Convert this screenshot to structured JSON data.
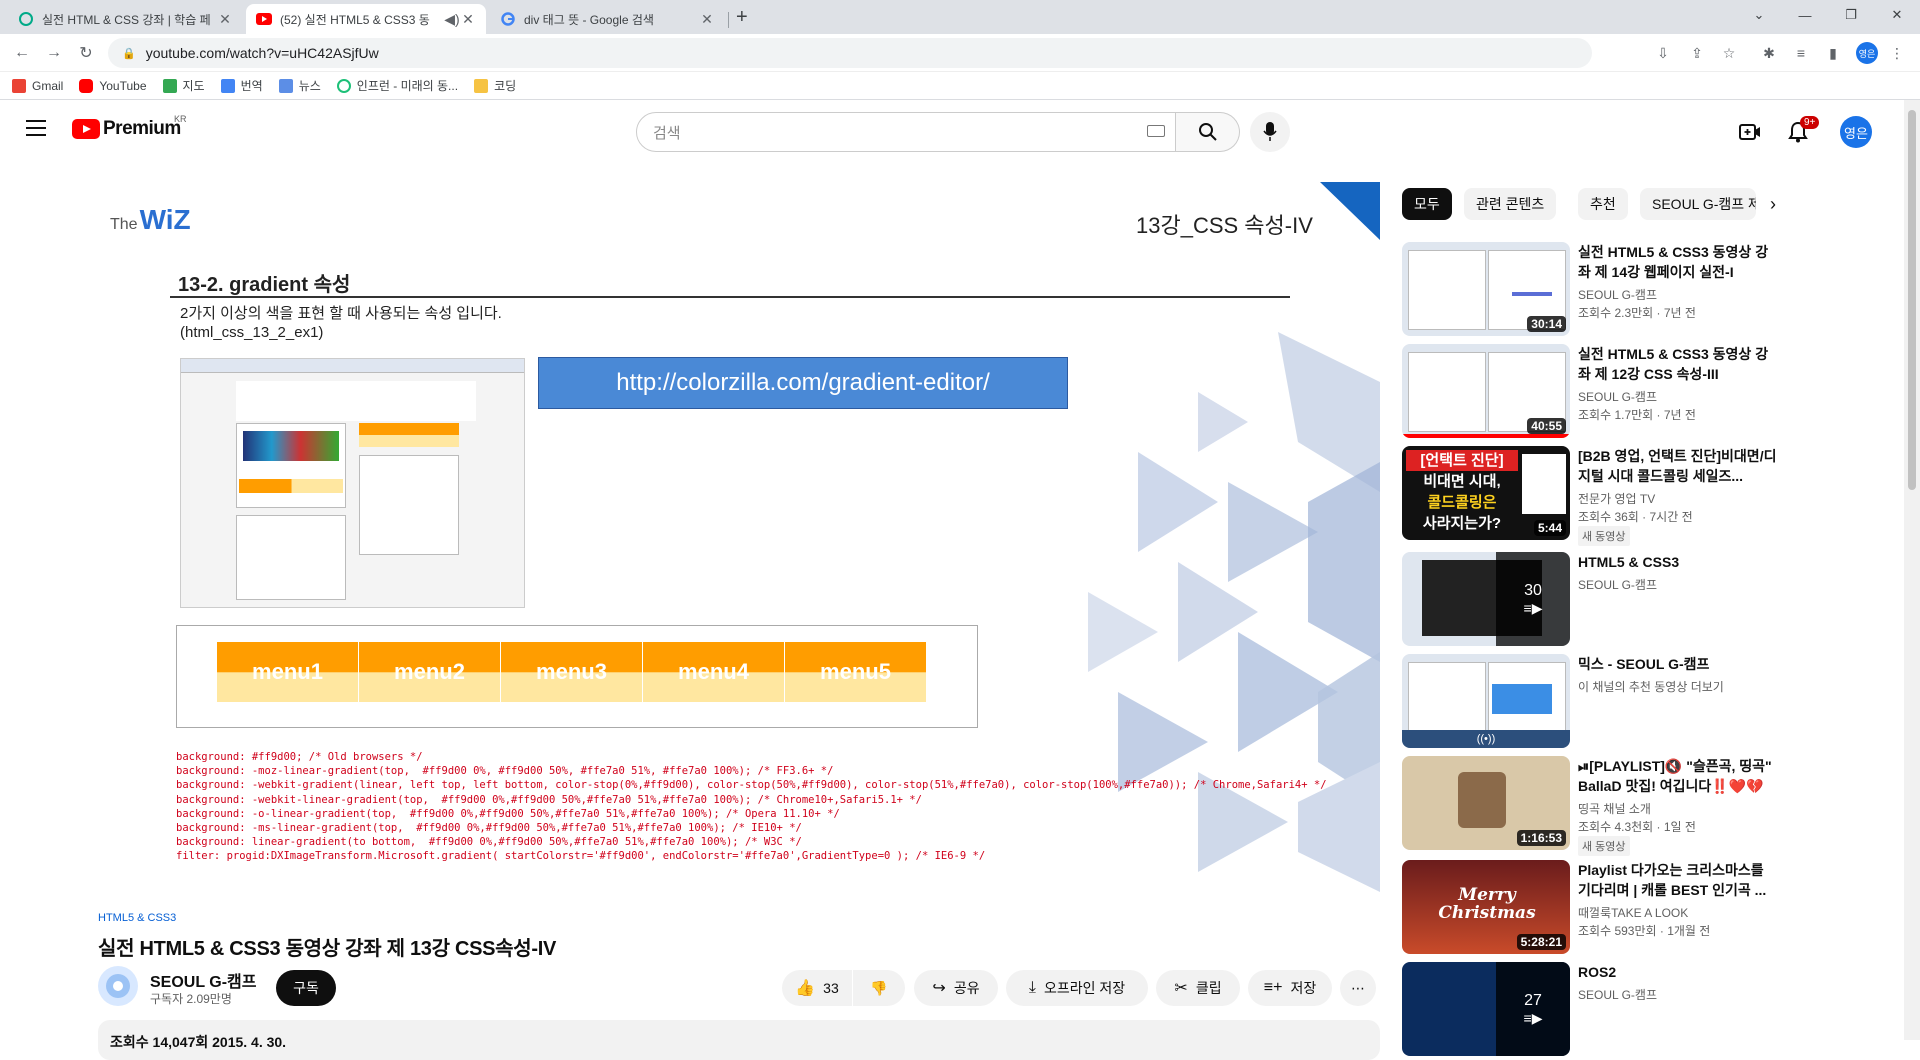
{
  "browser": {
    "tabs": [
      {
        "title": "실전 HTML & CSS 강좌 | 학습 페"
      },
      {
        "title": "(52) 실전 HTML5 & CSS3 동"
      },
      {
        "title": "div 태그 뜻 - Google 검색"
      }
    ],
    "url": "youtube.com/watch?v=uHC42ASjfUw",
    "bookmarks": [
      "Gmail",
      "YouTube",
      "지도",
      "번역",
      "뉴스",
      "인프런 - 미래의 동...",
      "코딩"
    ]
  },
  "header": {
    "logo": "Premium",
    "region": "KR",
    "search_placeholder": "검색",
    "notif_badge": "9+",
    "avatar": "영은"
  },
  "slide": {
    "brand_small": "The",
    "brand": "WiZ",
    "lecture": "13강_CSS 속성-IV",
    "heading": "13-2. gradient 속성",
    "desc_line1": "2가지 이상의 색을 표현 할 때 사용되는 속성 입니다.",
    "desc_line2": "(html_css_13_2_ex1)",
    "url_box": "http://colorzilla.com/gradient-editor/",
    "menus": [
      "menu1",
      "menu2",
      "menu3",
      "menu4",
      "menu5"
    ],
    "code": "background: #ff9d00; /* Old browsers */\nbackground: -moz-linear-gradient(top,  #ff9d00 0%, #ff9d00 50%, #ffe7a0 51%, #ffe7a0 100%); /* FF3.6+ */\nbackground: -webkit-gradient(linear, left top, left bottom, color-stop(0%,#ff9d00), color-stop(50%,#ff9d00), color-stop(51%,#ffe7a0), color-stop(100%,#ffe7a0)); /* Chrome,Safari4+ */\nbackground: -webkit-linear-gradient(top,  #ff9d00 0%,#ff9d00 50%,#ffe7a0 51%,#ffe7a0 100%); /* Chrome10+,Safari5.1+ */\nbackground: -o-linear-gradient(top,  #ff9d00 0%,#ff9d00 50%,#ffe7a0 51%,#ffe7a0 100%); /* Opera 11.10+ */\nbackground: -ms-linear-gradient(top,  #ff9d00 0%,#ff9d00 50%,#ffe7a0 51%,#ffe7a0 100%); /* IE10+ */\nbackground: linear-gradient(to bottom,  #ff9d00 0%,#ff9d00 50%,#ffe7a0 51%,#ffe7a0 100%); /* W3C */\nfilter: progid:DXImageTransform.Microsoft.gradient( startColorstr='#ff9d00', endColorstr='#ffe7a0',GradientType=0 ); /* IE6-9 */"
  },
  "video": {
    "category": "HTML5 & CSS3",
    "title": "실전 HTML5 & CSS3 동영상 강좌 제 13강 CSS속성-IV",
    "channel": "SEOUL G-캠프",
    "subscribers": "구독자 2.09만명",
    "subscribe_label": "구독",
    "likes": "33",
    "share_label": "공유",
    "offline_label": "오프라인 저장",
    "clip_label": "클립",
    "save_label": "저장",
    "description_stub": "조회수 14,047회  2015. 4. 30."
  },
  "sidebar": {
    "chips": [
      "모두",
      "관련 콘텐츠",
      "추천",
      "SEOUL G-캠프 제"
    ],
    "recs": [
      {
        "title": "실전 HTML5 & CSS3 동영상 강좌 제 14강 웹페이지 실전-I",
        "channel": "SEOUL G-캠프",
        "meta": "조회수 2.3만회 · 7년 전",
        "duration": "30:14"
      },
      {
        "title": "실전 HTML5 & CSS3 동영상 강좌 제 12강 CSS 속성-III",
        "channel": "SEOUL G-캠프",
        "meta": "조회수 1.7만회 · 7년 전",
        "duration": "40:55"
      },
      {
        "title": "[B2B 영업, 언택트 진단]비대면/디지털 시대 콜드콜링 세일즈...",
        "channel": "전문가 영업 TV",
        "meta": "조회수 36회 · 7시간 전",
        "duration": "5:44",
        "badge": "새 동영상",
        "thumb_line1": "[언택트 진단]",
        "thumb_line2": "비대면 시대,",
        "thumb_line3": "콜드콜링은",
        "thumb_line4": "사라지는가?"
      },
      {
        "title": "HTML5 & CSS3",
        "channel": "SEOUL G-캠프",
        "count": "30"
      },
      {
        "title": "믹스 - SEOUL G-캠프",
        "channel": "이 채널의 추천 동영상 더보기"
      },
      {
        "title": "⏯[PLAYLIST]🔇 \"슬픈곡, 띵곡\" BallaD 맛집! 여깁니다‼️❤️💔",
        "channel": "띵곡 채널 소개",
        "meta": "조회수 4.3천회 · 1일 전",
        "duration": "1:16:53",
        "badge": "새 동영상"
      },
      {
        "title": "Playlist 다가오는 크리스마스를 기다리며 | 캐롤 BEST 인기곡 ...",
        "channel": "때껄룩TAKE A LOOK",
        "meta": "조회수 593만회 · 1개월 전",
        "duration": "5:28:21",
        "thumb_text": "Merry Christmas"
      },
      {
        "title": "ROS2",
        "channel": "SEOUL G-캠프",
        "count": "27"
      }
    ]
  },
  "colors": {
    "accent": "#ff0000",
    "orange": "#ff9d00",
    "light_orange": "#ffe7a0",
    "link": "#065fd4"
  }
}
